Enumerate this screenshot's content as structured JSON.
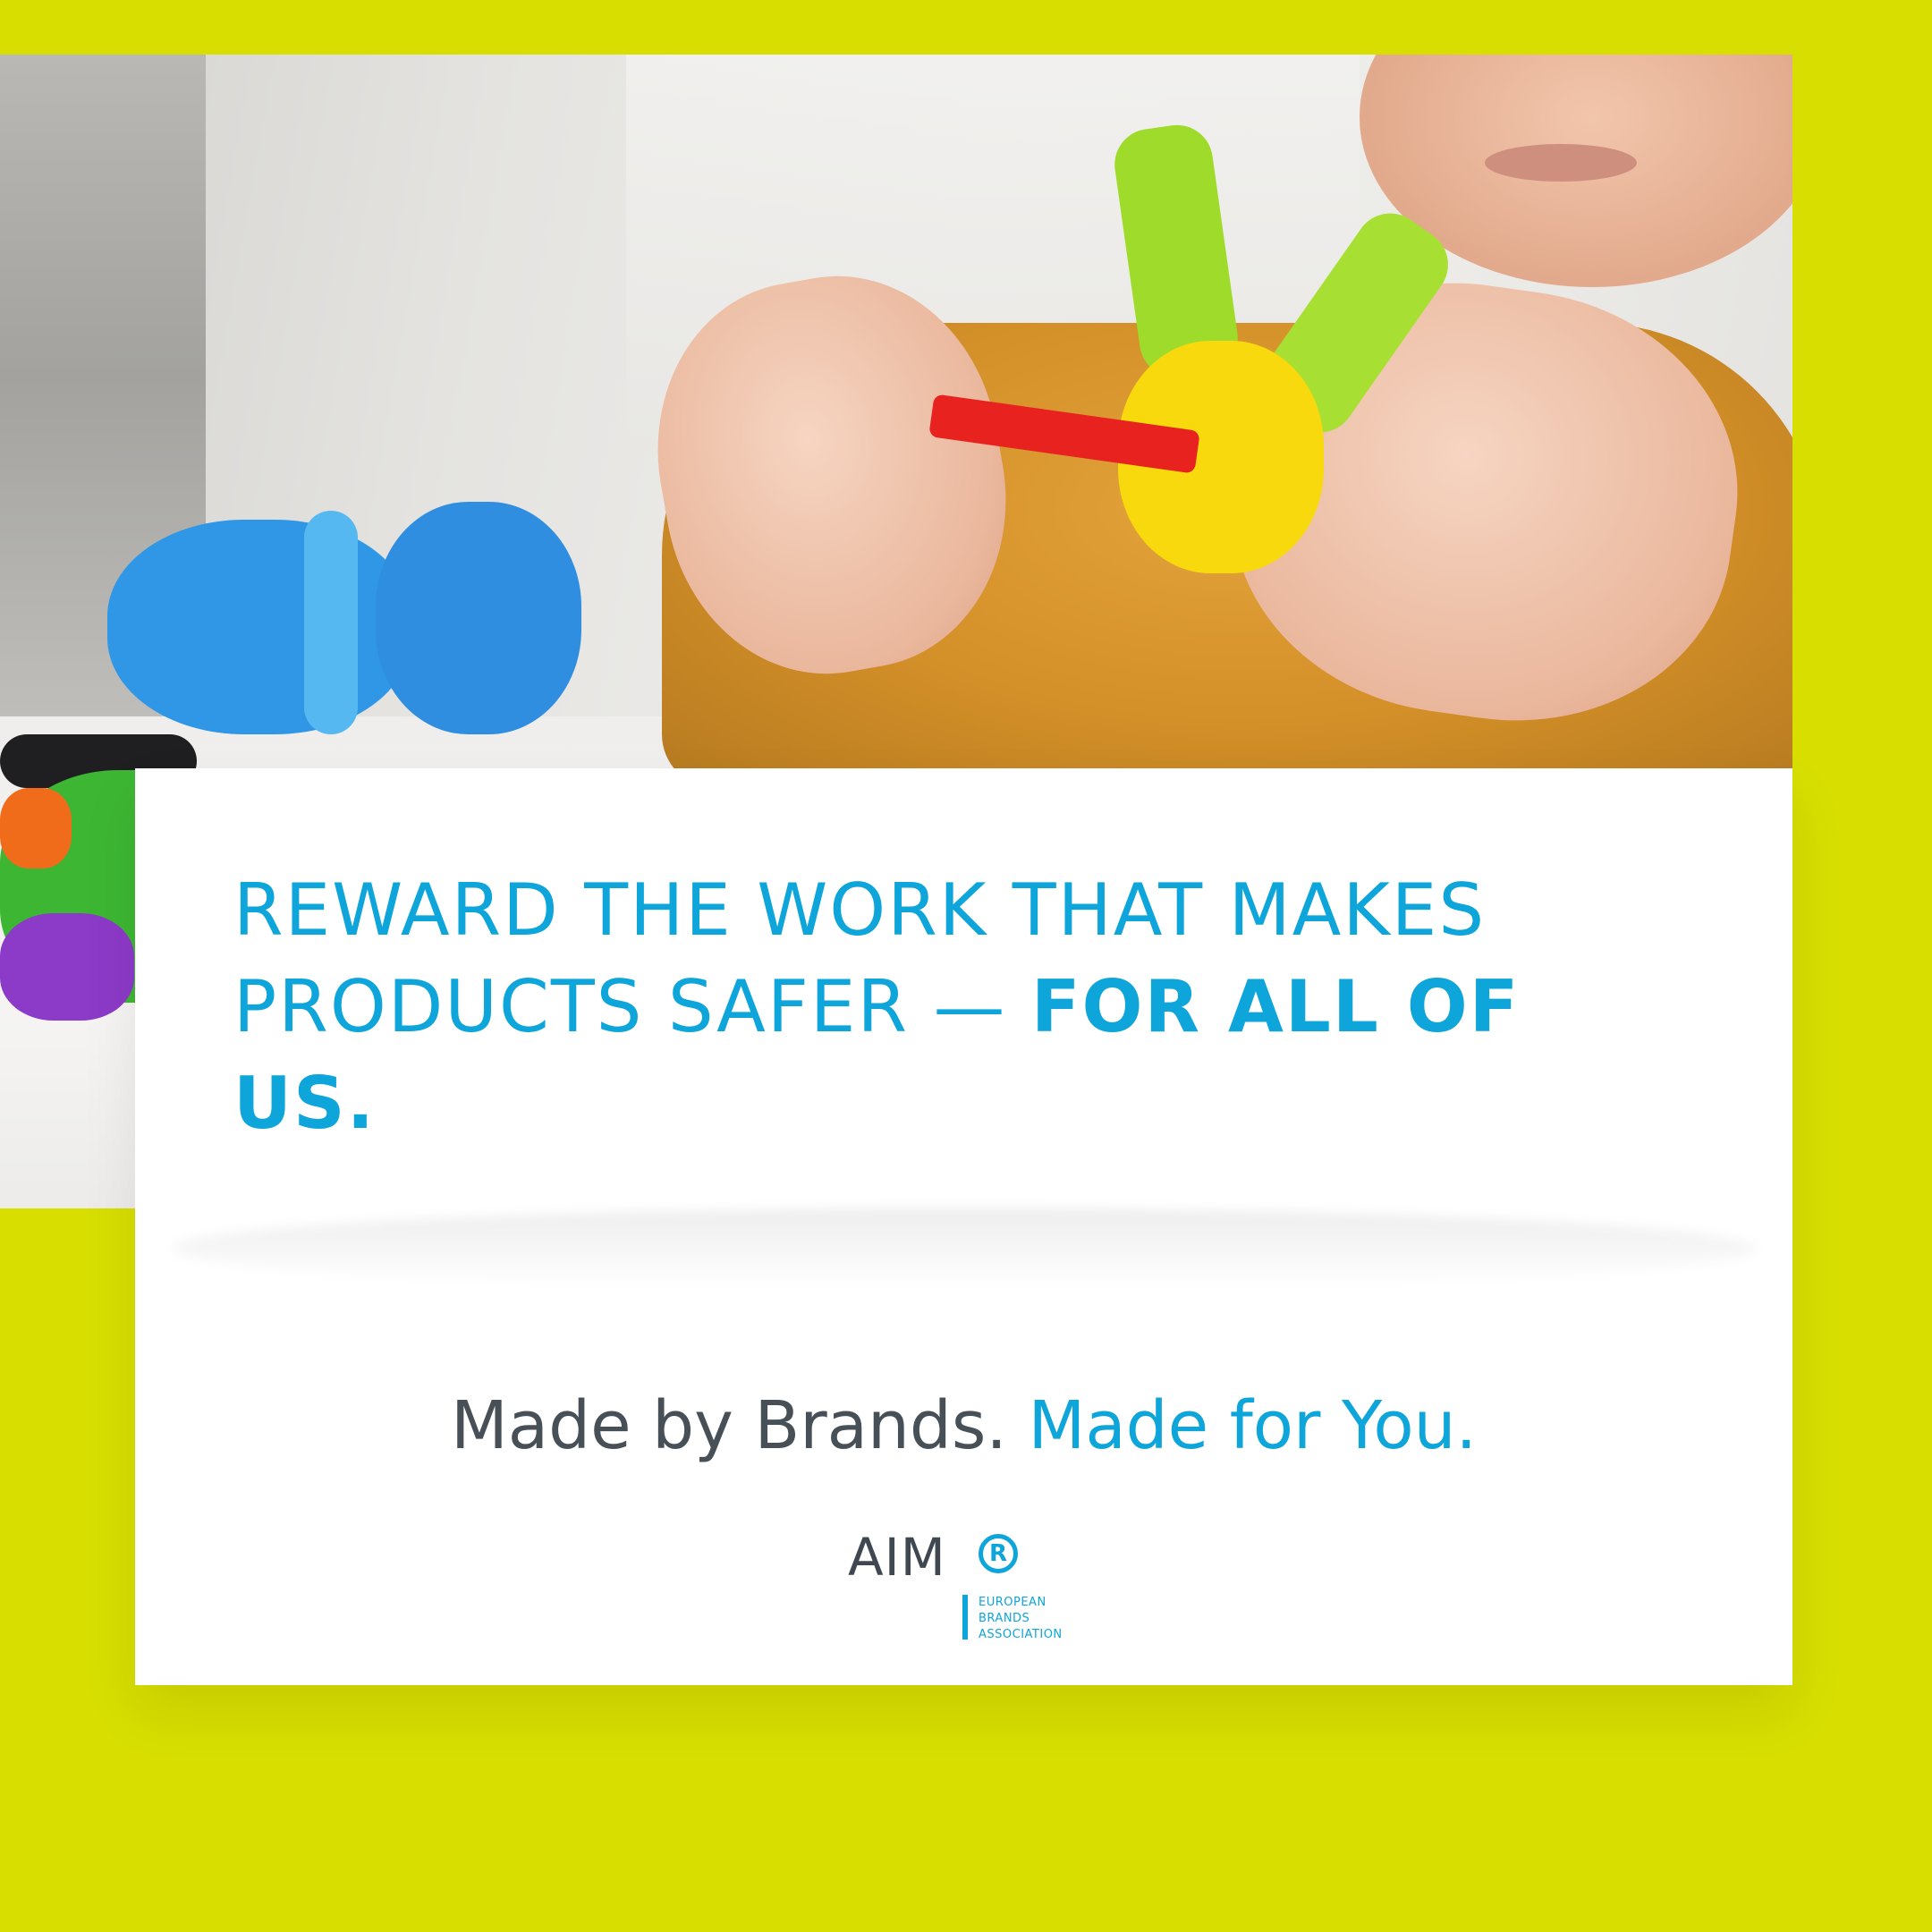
{
  "colors": {
    "background": "#d7de00",
    "card": "#ffffff",
    "accent_blue": "#0ea5da",
    "dark_gray": "#474f57"
  },
  "photo": {
    "subject": "child-hands-building-toy-pieces"
  },
  "headline": {
    "line1": "REWARD THE WORK THAT MAKES",
    "line2_regular": "PRODUCTS SAFER — ",
    "line2_bold": "FOR ALL OF",
    "line3_bold": "US."
  },
  "tagline": {
    "part1": "Made by Brands.",
    "part2": "Made for You."
  },
  "logo": {
    "name": "AIM",
    "registered_mark": "R",
    "sub_lines": [
      "EUROPEAN",
      "BRANDS",
      "ASSOCIATION"
    ]
  }
}
